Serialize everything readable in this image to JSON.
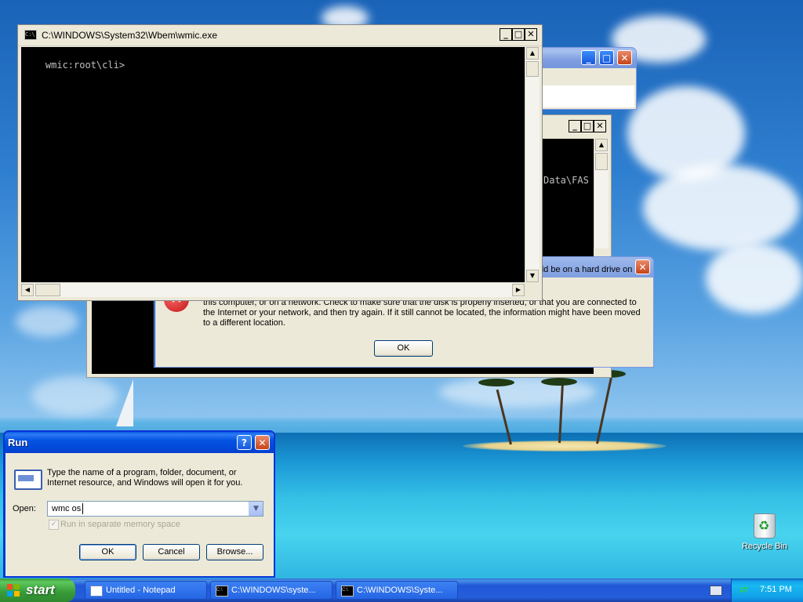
{
  "wmic_window": {
    "title": "C:\\WINDOWS\\System32\\Wbem\\wmic.exe",
    "console_text": "wmic:root\\cli>"
  },
  "back_window_1": {
    "title": ""
  },
  "back_window_2": {
    "console_text": "Data\\FAS"
  },
  "error_dialog": {
    "message_line1": "could be on a hard drive on",
    "message_rest": "this computer, or on a network. Check to make sure that the disk is properly inserted, or that you are connected to the Internet or your network, and then try again. If it still cannot be located, the information might have been moved to a different location.",
    "ok_label": "OK"
  },
  "run_dialog": {
    "title": "Run",
    "description": "Type the name of a program, folder, document, or Internet resource, and Windows will open it for you.",
    "open_label": "Open:",
    "open_value": "wmc os ",
    "checkbox_label": "Run in separate memory space",
    "ok_label": "OK",
    "cancel_label": "Cancel",
    "browse_label": "Browse..."
  },
  "desktop": {
    "recycle_bin_label": "Recycle Bin"
  },
  "taskbar": {
    "start_label": "start",
    "items": [
      {
        "label": "Untitled - Notepad",
        "icon": "notepad-icon"
      },
      {
        "label": "C:\\WINDOWS\\syste...",
        "icon": "console-icon"
      },
      {
        "label": "C:\\WINDOWS\\Syste...",
        "icon": "console-icon"
      }
    ],
    "clock": "7:51 PM"
  },
  "colors": {
    "title_active": "#0054e3",
    "taskbar": "#245edb",
    "start_green": "#3c9a3c",
    "error_red": "#cc2222"
  }
}
